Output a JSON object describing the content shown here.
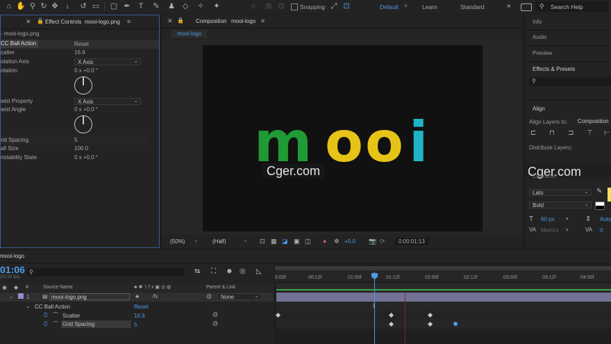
{
  "toolbar": {
    "snapping_label": "Snapping",
    "workspaces": [
      "Default",
      "Learn",
      "Standard"
    ],
    "search_placeholder": "Search Help"
  },
  "effect_controls": {
    "tab_label": "Effect Controls",
    "layer_name": "mooi-logo.png",
    "breadcrumb": "- mooi-logo.png",
    "effect_name": "CC Ball Action",
    "reset_label": "Reset",
    "props": [
      {
        "name": "Scatter",
        "value": "16.9"
      },
      {
        "name": "Rotation Axis",
        "value": "X Axis"
      },
      {
        "name": "Rotation",
        "value": "0 x +0.0 °"
      },
      {
        "name": "Twist Property",
        "value": "X Axis"
      },
      {
        "name": "Twist Angle",
        "value": "0 x +0.0 °"
      },
      {
        "name": "Grid Spacing",
        "value": "5"
      },
      {
        "name": "Ball Size",
        "value": "100.0"
      },
      {
        "name": "Instability State",
        "value": "0 x +0.0 °"
      }
    ],
    "display_names": {
      "effect": "CC Ball Action",
      "scatter": "catter",
      "rotation_axis": "otation Axis",
      "rotation": "otation",
      "twist_property": "wist Property",
      "twist_angle": "wist Angle",
      "grid_spacing": "rid Spacing",
      "ball_size": "all Size",
      "instability": "nstability State"
    }
  },
  "composition": {
    "tab_prefix": "Composition",
    "comp_name": "mooi-logo",
    "sub_tab": "mooi-logo",
    "logo_letters": [
      "m",
      "o",
      "o",
      "i"
    ],
    "zoom": "(50%)",
    "resolution": "(Half)",
    "exposure": "+0.0",
    "timecode": "0:00:01:13",
    "watermark": "Cger.com"
  },
  "right_panel": {
    "tabs": [
      "Info",
      "Audio",
      "Preview",
      "Effects & Presets"
    ],
    "align_title": "Align",
    "align_layers_to_label": "Align Layers to:",
    "align_layers_to_value": "Composition",
    "distribute_label": "Distribute Layers:",
    "character_title": "Character",
    "font_name": "Lato",
    "font_style": "Bold",
    "font_size": "60 px",
    "tracking_label": "Metrics",
    "leading": "Auto",
    "tracking_value": "0",
    "watermark": "Cger.com"
  },
  "timeline": {
    "comp_tab": "mooi-logo",
    "current_time": "01:06",
    "fps_hint": "(30.00 fps)",
    "columns": {
      "num": "#",
      "source": "Source Name",
      "parent": "Parent & Link"
    },
    "layer": {
      "index": "1",
      "name": "mooi-logo.png",
      "parent": "None"
    },
    "effect_name": "CC Ball Action",
    "reset_label": "Reset",
    "props": [
      {
        "name": "Scatter",
        "value": "16.9"
      },
      {
        "name": "Grid Spacing",
        "value": "5"
      }
    ],
    "ruler_labels": [
      "0:00f",
      "00:12f",
      "01:00f",
      "01:12f",
      "02:00f",
      "02:12f",
      "03:00f",
      "03:12f",
      "04:00f"
    ]
  }
}
